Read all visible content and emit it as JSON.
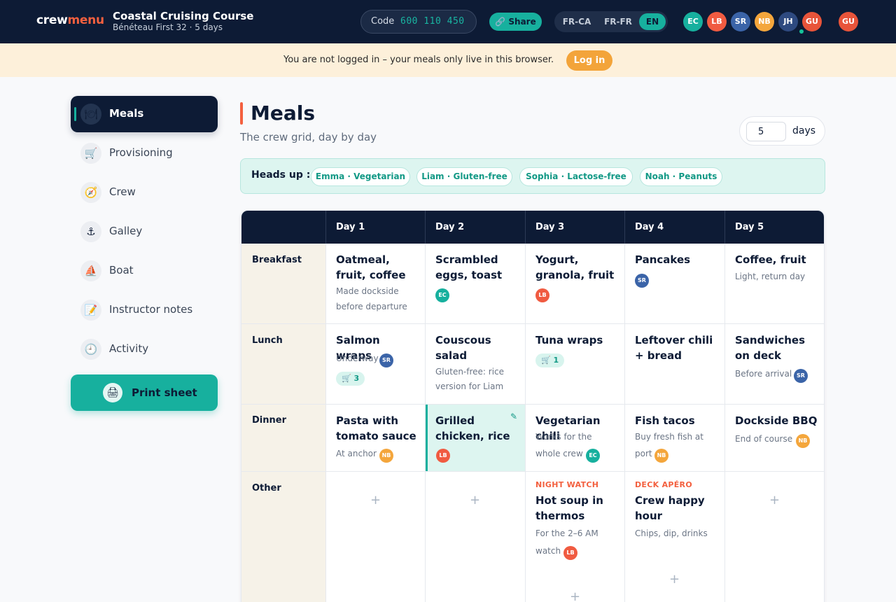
{
  "app": {
    "logo_a": "crew",
    "logo_b": "menu",
    "title": "Coastal Cruising Course",
    "subtitle": "Bénéteau First 32 · 5 days"
  },
  "header": {
    "code_label": "Code",
    "code_value": "600 110 450",
    "share_label": "Share",
    "languages": [
      "FR-CA",
      "FR-FR",
      "EN"
    ],
    "active_language": "EN",
    "crew_avatars": [
      {
        "initials": "EC",
        "color": "#17b09e"
      },
      {
        "initials": "LB",
        "color": "#f05b41"
      },
      {
        "initials": "SR",
        "color": "#3b64a8"
      },
      {
        "initials": "NB",
        "color": "#f4a63c"
      },
      {
        "initials": "JH",
        "color": "#2e4a80"
      },
      {
        "initials": "GU",
        "color": "#e8543a"
      }
    ],
    "user_avatar": {
      "initials": "GU",
      "color": "#e8543a"
    }
  },
  "banner": {
    "text": "You are not logged in – your meals only live in this browser.",
    "login_label": "Log in"
  },
  "sidebar": {
    "items": [
      {
        "label": "Meals",
        "icon": "plate-icon",
        "glyph": "🍽"
      },
      {
        "label": "Provisioning",
        "icon": "cart-icon",
        "glyph": "🛒"
      },
      {
        "label": "Crew",
        "icon": "compass-icon",
        "glyph": "🧭"
      },
      {
        "label": "Galley",
        "icon": "anchor-icon",
        "glyph": "⚓"
      },
      {
        "label": "Boat",
        "icon": "sailboat-icon",
        "glyph": "⛵"
      },
      {
        "label": "Instructor notes",
        "icon": "notes-icon",
        "glyph": "📝"
      },
      {
        "label": "Activity",
        "icon": "clock-icon",
        "glyph": "🕘"
      }
    ],
    "print_label": "Print sheet",
    "print_icon": "printer-icon"
  },
  "main": {
    "title": "Meals",
    "subtitle": "The crew grid, day by day",
    "days_value": "5",
    "days_label": "days",
    "heads_label": "Heads up :",
    "heads_chips": [
      "Emma · Vegetarian",
      "Liam · Gluten-free",
      "Sophia · Lactose-free",
      "Noah · Peanuts"
    ]
  },
  "grid": {
    "days": [
      "Day 1",
      "Day 2",
      "Day 3",
      "Day 4",
      "Day 5"
    ],
    "meals": [
      "Breakfast",
      "Lunch",
      "Dinner",
      "Other"
    ],
    "cells": {
      "b1": {
        "dish": "Oatmeal, fruit, coffee",
        "note1": "Made dockside",
        "note2": "before departure"
      },
      "b2": {
        "dish": "Scrambled eggs, toast",
        "avatar": "EC"
      },
      "b3": {
        "dish": "Yogurt, granola, fruit",
        "avatar": "LB"
      },
      "b4": {
        "dish": "Pancakes",
        "avatar": "SR"
      },
      "b5": {
        "dish": "Coffee, fruit",
        "note1": "Light, return day"
      },
      "l1": {
        "dish": "Salmon wraps",
        "note1": "Underway",
        "avatar": "SR",
        "cart": "3"
      },
      "l2": {
        "dish": "Couscous salad",
        "note1": "Gluten-free: rice",
        "note2": "version for Liam"
      },
      "l3": {
        "dish": "Tuna wraps",
        "cart": "1"
      },
      "l4": {
        "dish": "Leftover chili + bread"
      },
      "l5": {
        "dish": "Sandwiches on deck",
        "note1": "Before arrival",
        "avatar": "SR"
      },
      "d1": {
        "dish": "Pasta with tomato sauce",
        "note1": "At anchor",
        "avatar": "NB"
      },
      "d2": {
        "dish": "Grilled chicken, rice",
        "avatar": "LB"
      },
      "d3": {
        "dish": "Vegetarian chili",
        "note1": "Works for the",
        "note2": "whole crew",
        "avatar": "EC"
      },
      "d4": {
        "dish": "Fish tacos",
        "note1": "Buy fresh fish at",
        "note2": "port",
        "avatar": "NB"
      },
      "d5": {
        "dish": "Dockside BBQ",
        "note1": "End of course",
        "avatar": "NB"
      },
      "o3": {
        "tag": "NIGHT WATCH",
        "dish": "Hot soup in thermos",
        "note1": "For the 2–6 AM",
        "note2": "watch",
        "avatar": "LB"
      },
      "o4": {
        "tag": "DECK APÉRO",
        "dish": "Crew happy hour",
        "note1": "Chips, dip, drinks"
      }
    },
    "add_symbol": "+"
  }
}
